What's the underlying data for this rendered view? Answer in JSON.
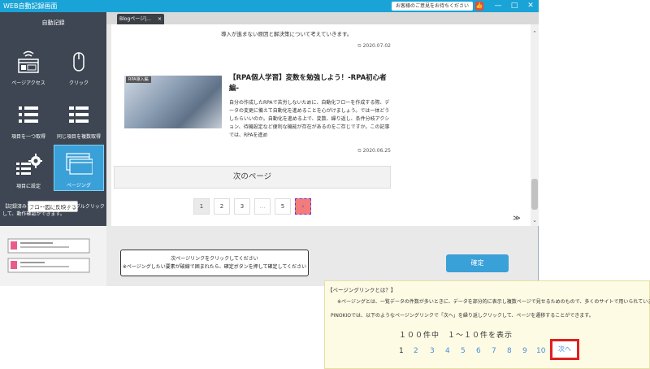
{
  "window": {
    "title": "WEB自動記録画面",
    "feedback": "お客様のご意見をお待ちください",
    "controls": [
      "—",
      "□",
      "✕"
    ]
  },
  "sidebar": {
    "heading": "自動記録",
    "tools": [
      {
        "label": "ページアクセス",
        "icon": "browser-window-icon"
      },
      {
        "label": "クリック",
        "icon": "mouse-icon"
      },
      {
        "label": "項目を一つ取得",
        "icon": "list-icon"
      },
      {
        "label": "同じ項目を複数取得",
        "icon": "multi-list-icon"
      },
      {
        "label": "項目に設定",
        "icon": "gear-list-icon"
      },
      {
        "label": "ページング",
        "icon": "paging-icon"
      }
    ],
    "flow_button": "フロー図に反映する",
    "note": "【記録済みフロー】アイコンをダブルクリックして、動作確認ができます。"
  },
  "tab": {
    "label": "Blogページ|...",
    "close": "×"
  },
  "content": {
    "snippet": "導入が進まない原因と解決策について考えていきます。",
    "date1": "2020.07.02",
    "badge": "RPA導入編",
    "title": "【RPA個人学習】変数を勉強しよう！-RPA初心者編-",
    "body": "自分の作成したRPAで苦労しないために、自動化フローを作成する際、データの変更に備えて自動化を進めることを心がけましょう。では一体どうしたらいいのか。自動化を進める上で、変数、繰り返し、条件分岐アクション、待機設定など便利な機能が存在があるのをご存じですか。この記事では、RPAを進め",
    "date2": "2020.06.25",
    "next_page": "次のページ",
    "pages": [
      "1",
      "2",
      "3",
      "…",
      "5",
      "›"
    ],
    "top_button": "≫"
  },
  "instruction": {
    "line1": "次ページリンクをクリックしてください",
    "line2": "※ページングしたい要素が破線で囲まれたら、確定ボタンを押して確定してください"
  },
  "confirm_button": "確定",
  "help": {
    "title": "【ページングリンクとは？】",
    "line1": "※ページングとは、一覧データの件数が多いときに、データを部分的に表示し複数ページで見せるためのもので、多くのサイトで用いられています。",
    "line2": "PINOKIOでは、以下のようなページングリンクで「次へ」を繰り返しクリックして、ページを遷移することができます。",
    "sample_text": "１００件中　１～１０件を表示",
    "sample_pages": [
      "1",
      "2",
      "3",
      "4",
      "5",
      "6",
      "7",
      "8",
      "9",
      "10"
    ],
    "next_label": "次へ"
  }
}
